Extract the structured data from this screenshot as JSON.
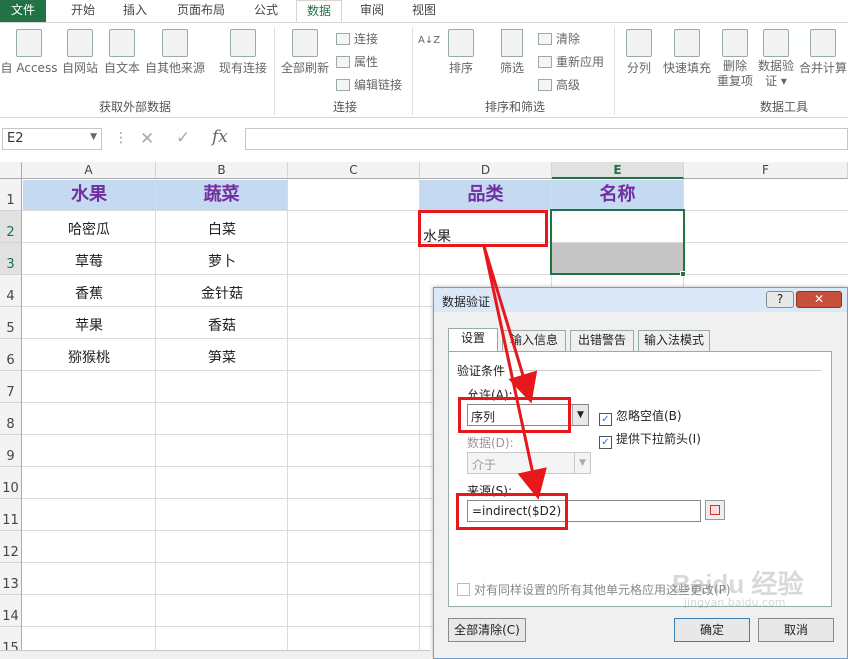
{
  "tabs": [
    "文件",
    "开始",
    "插入",
    "页面布局",
    "公式",
    "数据",
    "审阅",
    "视图"
  ],
  "ribbon": {
    "ext_buttons": [
      "自 Access",
      "自网站",
      "自文本",
      "自其他来源",
      "现有连接"
    ],
    "refresh": "全部刷新",
    "connections": [
      "连接",
      "属性",
      "编辑链接"
    ],
    "sort_az": "A↓Z",
    "sort": "排序",
    "filter": "筛选",
    "filter_small": [
      "清除",
      "重新应用",
      "高级"
    ],
    "tools": [
      "分列",
      "快速填充",
      "删除\n重复项",
      "数据验\n证 ▾",
      "合并计算"
    ],
    "groups": {
      "external": "获取外部数据",
      "connect": "连接",
      "sortfilter": "排序和筛选",
      "datatools": "数据工具"
    }
  },
  "formula_bar": {
    "name_box": "E2",
    "fx": "fx",
    "cancel": "✕",
    "confirm": "✓"
  },
  "columns": [
    "A",
    "B",
    "C",
    "D",
    "E",
    "F"
  ],
  "rows": [
    "1",
    "2",
    "3",
    "4",
    "5",
    "6",
    "7",
    "8",
    "9",
    "10",
    "11",
    "12",
    "13",
    "14",
    "15"
  ],
  "sheet": {
    "A1": "水果",
    "B1": "蔬菜",
    "D1": "品类",
    "E1": "名称",
    "fruits": [
      "哈密瓜",
      "草莓",
      "香蕉",
      "苹果",
      "猕猴桃"
    ],
    "vegetables": [
      "白菜",
      "萝卜",
      "金针菇",
      "香菇",
      "笋菜"
    ],
    "D2": "水果"
  },
  "dialog": {
    "title": "数据验证",
    "help": "?",
    "close": "✕",
    "tabs": [
      "设置",
      "输入信息",
      "出错警告",
      "输入法模式"
    ],
    "section": "验证条件",
    "allow_label": "允许(A):",
    "allow_value": "序列",
    "data_label": "数据(D):",
    "data_value": "介于",
    "ignore_blank": "忽略空值(B)",
    "dropdown": "提供下拉箭头(I)",
    "source_label": "来源(S):",
    "source_value": "=indirect($D2)",
    "apply_all": "对有同样设置的所有其他单元格应用这些更改(P)",
    "clear_all": "全部清除(C)",
    "ok": "确定",
    "cancel": "取消"
  },
  "watermark": "Baidu 经验",
  "watermark_url": "jingyan.baidu.com",
  "colors": {
    "excel_green": "#217346",
    "header_fill": "#c5d9f1",
    "header_text": "#7030a0",
    "annotation_red": "#e8171c"
  }
}
